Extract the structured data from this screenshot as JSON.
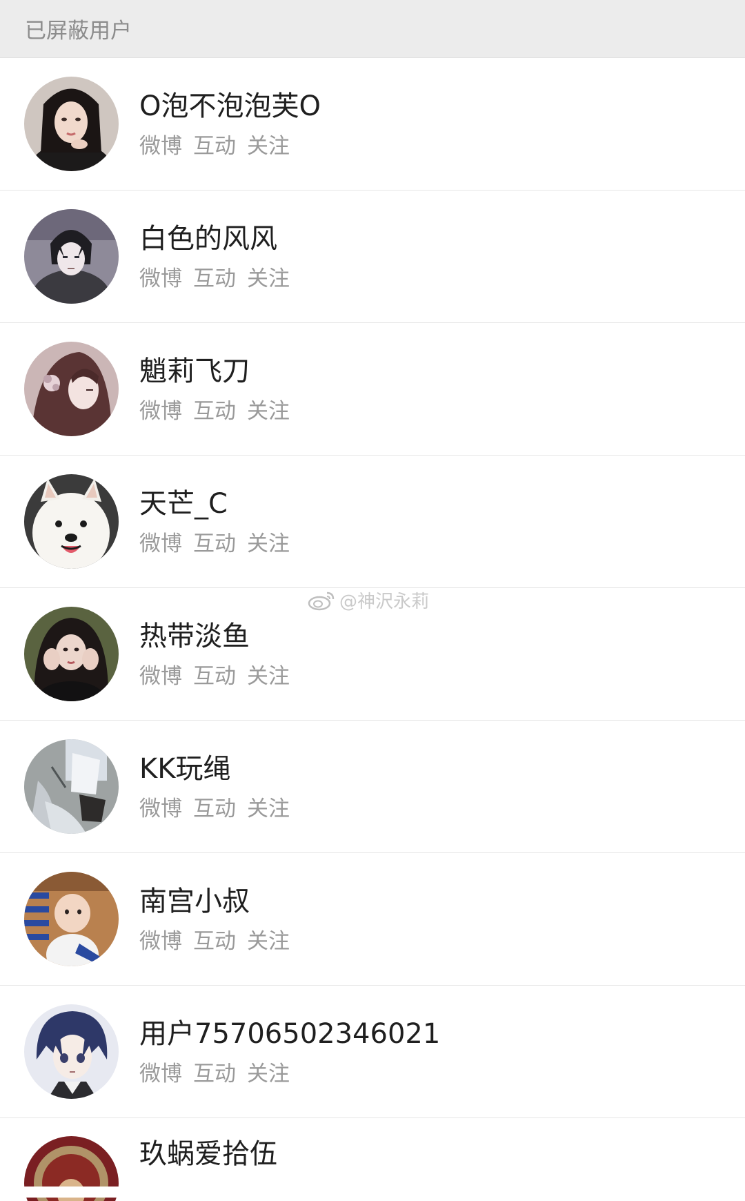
{
  "header": {
    "title": "已屏蔽用户"
  },
  "actions": {
    "weibo": "微博",
    "interact": "互动",
    "follow": "关注"
  },
  "users": [
    {
      "name": "O泡不泡泡芙O",
      "avatar": "avatar-girl-portrait"
    },
    {
      "name": "白色的风风",
      "avatar": "avatar-anime-boy"
    },
    {
      "name": "魈莉飞刀",
      "avatar": "avatar-anime-girl"
    },
    {
      "name": "天芒_C",
      "avatar": "avatar-samoyed-dog"
    },
    {
      "name": "热带淡鱼",
      "avatar": "avatar-girl-hands-face"
    },
    {
      "name": "KK玩绳",
      "avatar": "avatar-illustration-figure"
    },
    {
      "name": "南宫小叔",
      "avatar": "avatar-baby-photo"
    },
    {
      "name": "用户7570650234602​1",
      "avatar": "avatar-anime-dark-hair"
    },
    {
      "name": "玖蜗爱拾伍",
      "avatar": "avatar-red-emblem"
    }
  ],
  "watermark": {
    "text": "@神沢永莉"
  },
  "colors": {
    "header_bg": "#ececec",
    "name_text": "#1f1f1f",
    "action_text": "#9a9a9a",
    "divider": "#e6e6e6"
  }
}
